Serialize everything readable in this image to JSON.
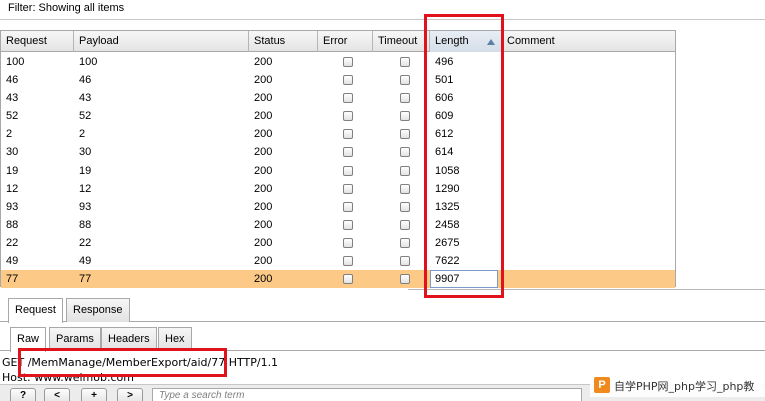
{
  "filter": {
    "text": "Filter:  Showing all items"
  },
  "table": {
    "columns": [
      "Request",
      "Payload",
      "Status",
      "Error",
      "Timeout",
      "Length",
      "Comment"
    ],
    "sorted_column": "Length",
    "rows": [
      {
        "request": "100",
        "payload": "100",
        "status": "200",
        "error": false,
        "timeout": false,
        "length": "496"
      },
      {
        "request": "46",
        "payload": "46",
        "status": "200",
        "error": false,
        "timeout": false,
        "length": "501"
      },
      {
        "request": "43",
        "payload": "43",
        "status": "200",
        "error": false,
        "timeout": false,
        "length": "606"
      },
      {
        "request": "52",
        "payload": "52",
        "status": "200",
        "error": false,
        "timeout": false,
        "length": "609"
      },
      {
        "request": "2",
        "payload": "2",
        "status": "200",
        "error": false,
        "timeout": false,
        "length": "612"
      },
      {
        "request": "30",
        "payload": "30",
        "status": "200",
        "error": false,
        "timeout": false,
        "length": "614"
      },
      {
        "request": "19",
        "payload": "19",
        "status": "200",
        "error": false,
        "timeout": false,
        "length": "1058"
      },
      {
        "request": "12",
        "payload": "12",
        "status": "200",
        "error": false,
        "timeout": false,
        "length": "1290"
      },
      {
        "request": "93",
        "payload": "93",
        "status": "200",
        "error": false,
        "timeout": false,
        "length": "1325"
      },
      {
        "request": "88",
        "payload": "88",
        "status": "200",
        "error": false,
        "timeout": false,
        "length": "2458"
      },
      {
        "request": "22",
        "payload": "22",
        "status": "200",
        "error": false,
        "timeout": false,
        "length": "2675"
      },
      {
        "request": "49",
        "payload": "49",
        "status": "200",
        "error": false,
        "timeout": false,
        "length": "7622"
      },
      {
        "request": "77",
        "payload": "77",
        "status": "200",
        "error": false,
        "timeout": false,
        "length": "9907",
        "selected": true
      }
    ]
  },
  "tabs_main": [
    "Request",
    "Response"
  ],
  "tabs_main_active": "Request",
  "tabs_sub": [
    "Raw",
    "Params",
    "Headers",
    "Hex"
  ],
  "tabs_sub_active": "Raw",
  "request": {
    "line": "GET /MemManage/MemberExport/aid/77 HTTP/1.1",
    "host": "Host: www.weimob.com"
  },
  "bottom_bar": {
    "help_label": "?",
    "prev_label": "<",
    "add_label": "+",
    "next_label": ">",
    "search_placeholder": "Type a search term"
  },
  "watermark": {
    "logo": "P",
    "text": "自学PHP网_php学习_php教"
  },
  "colors": {
    "selected_row": "#fcc987",
    "highlight_box": "#e0121b"
  }
}
